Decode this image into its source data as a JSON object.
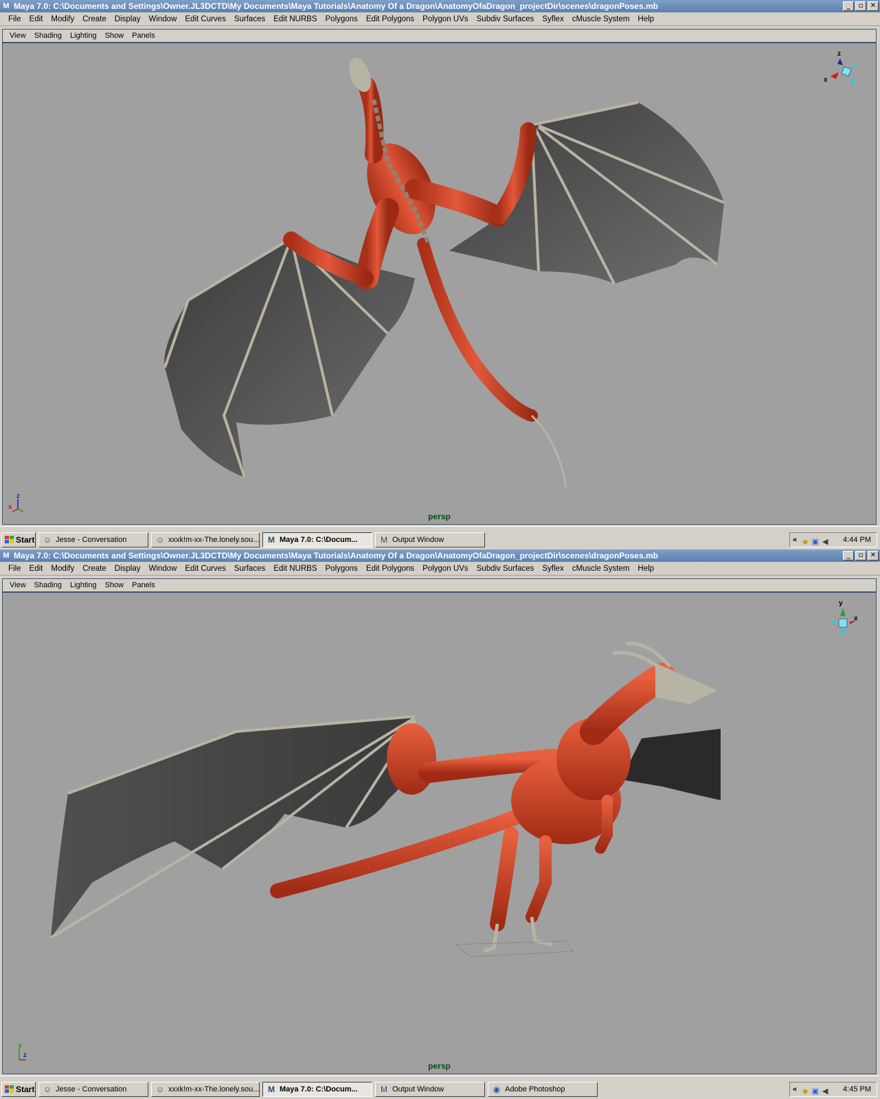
{
  "screens": [
    {
      "window_title": "Maya 7.0: C:\\Documents and Settings\\Owner.JL3DCTD\\My Documents\\Maya Tutorials\\Anatomy Of a Dragon\\AnatomyOfaDragon_projectDir\\scenes\\dragonPoses.mb",
      "menu": [
        "File",
        "Edit",
        "Modify",
        "Create",
        "Display",
        "Window",
        "Edit Curves",
        "Surfaces",
        "Edit NURBS",
        "Polygons",
        "Edit Polygons",
        "Polygon UVs",
        "Subdiv Surfaces",
        "Syflex",
        "cMuscle System",
        "Help"
      ],
      "panel_menu": [
        "View",
        "Shading",
        "Lighting",
        "Show",
        "Panels"
      ],
      "camera_label": "persp",
      "view_cube_axes": [
        "z",
        "x"
      ],
      "corner_axes": [
        "z",
        "x"
      ],
      "taskbar": {
        "start_label": "Start",
        "tasks": [
          {
            "label": "Jesse - Conversation",
            "icon": "messenger-icon",
            "active": false
          },
          {
            "label": "xxxk!m-xx-The.lonely.sou...",
            "icon": "messenger-icon",
            "active": false
          },
          {
            "label": "Maya 7.0: C:\\Docum...",
            "icon": "maya-icon",
            "active": true
          },
          {
            "label": "Output Window",
            "icon": "maya-icon",
            "active": false
          }
        ],
        "tray_chevron": "«",
        "clock": "4:44 PM"
      }
    },
    {
      "window_title": "Maya 7.0: C:\\Documents and Settings\\Owner.JL3DCTD\\My Documents\\Maya Tutorials\\Anatomy Of a Dragon\\AnatomyOfaDragon_projectDir\\scenes\\dragonPoses.mb",
      "menu": [
        "File",
        "Edit",
        "Modify",
        "Create",
        "Display",
        "Window",
        "Edit Curves",
        "Surfaces",
        "Edit NURBS",
        "Polygons",
        "Edit Polygons",
        "Polygon UVs",
        "Subdiv Surfaces",
        "Syflex",
        "cMuscle System",
        "Help"
      ],
      "panel_menu": [
        "View",
        "Shading",
        "Lighting",
        "Show",
        "Panels"
      ],
      "camera_label": "persp",
      "view_cube_axes": [
        "y",
        "x"
      ],
      "corner_axes": [
        "y",
        "z"
      ],
      "taskbar": {
        "start_label": "Start",
        "tasks": [
          {
            "label": "Jesse - Conversation",
            "icon": "messenger-icon",
            "active": false
          },
          {
            "label": "xxxk!m-xx-The.lonely.sou...",
            "icon": "messenger-icon",
            "active": false
          },
          {
            "label": "Maya 7.0: C:\\Docum...",
            "icon": "maya-icon",
            "active": true
          },
          {
            "label": "Output Window",
            "icon": "maya-icon",
            "active": false
          },
          {
            "label": "Adobe Photoshop",
            "icon": "photoshop-icon",
            "active": false
          }
        ],
        "tray_chevron": "«",
        "clock": "4:45 PM"
      }
    }
  ],
  "colors": {
    "title_bar": "#5a80b0",
    "viewport_bg": "#a0a0a0",
    "muscle": "#d24a2a",
    "wing_membrane": "#5a5a5a",
    "bone": "#b8b4a4",
    "camera_label": "#0a4a1a"
  }
}
